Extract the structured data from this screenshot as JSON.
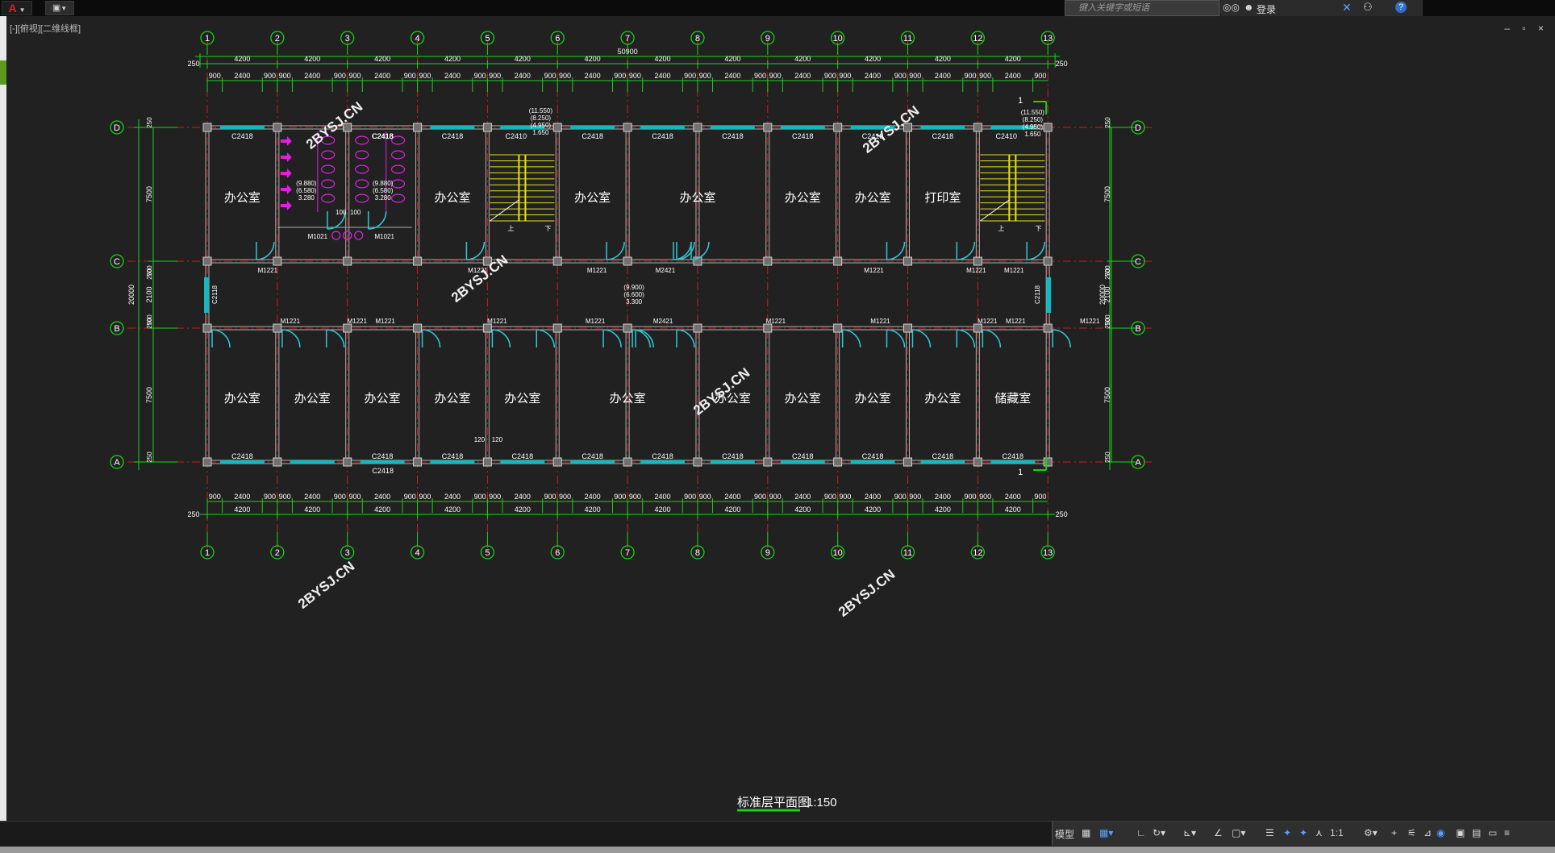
{
  "app": {
    "logo_letter": "A",
    "search_placeholder": "键入关键字或短语",
    "login_label": "登录",
    "help_label": "?",
    "viewport_label": "[-][俯视][二维线框]",
    "window_controls": "– ▫ ×"
  },
  "status_bar": {
    "model_tab": "模型",
    "scale": "1:1"
  },
  "drawing": {
    "grid_numbers": [
      "1",
      "2",
      "3",
      "4",
      "5",
      "6",
      "7",
      "8",
      "9",
      "10",
      "11",
      "12",
      "13"
    ],
    "grid_letters": [
      "D",
      "C",
      "B",
      "A"
    ],
    "total_dim": "50900",
    "end_dim": "250",
    "bay_dim": "4200",
    "sub_dims": [
      "900",
      "2400",
      "900"
    ],
    "vertical_total": "20000",
    "vertical_dims": [
      "7500",
      "2100",
      "7500"
    ],
    "small_dims": [
      "250",
      "700"
    ],
    "window_label": "C2418",
    "window_label_stair": "C2410",
    "window_label_side": "C2118",
    "door_single": "M1221",
    "door_double": "M2421",
    "door_wc": "M1021",
    "room_office": "办公室",
    "room_print": "打印室",
    "room_storage": "储藏室",
    "stair_up": "上",
    "stair_down": "下",
    "elev_stair": [
      "(11.550)",
      "(8.250)",
      "(4.950)",
      "1.650"
    ],
    "elev_wc": [
      "(9.880)",
      "(6.580)",
      "3.280"
    ],
    "elev_corridor": [
      "(9.900)",
      "(6.600)",
      "3.300"
    ],
    "wc_dims": [
      "100",
      "100"
    ],
    "col_dims": [
      "120",
      "120"
    ],
    "section_mark": "1",
    "watermark": "2BYSJ.CN",
    "title": "标准层平面图",
    "scale": "1:150"
  },
  "colors": {
    "background": "#212121",
    "dim_green": "#19d219",
    "axis_red": "#c81e1e",
    "wall": "#b0b0b0",
    "window": "#15b8c0",
    "door": "#2fc8d4",
    "fixture": "#e020e0",
    "stair": "#e6e020",
    "watermark": "#f0f0f0"
  }
}
